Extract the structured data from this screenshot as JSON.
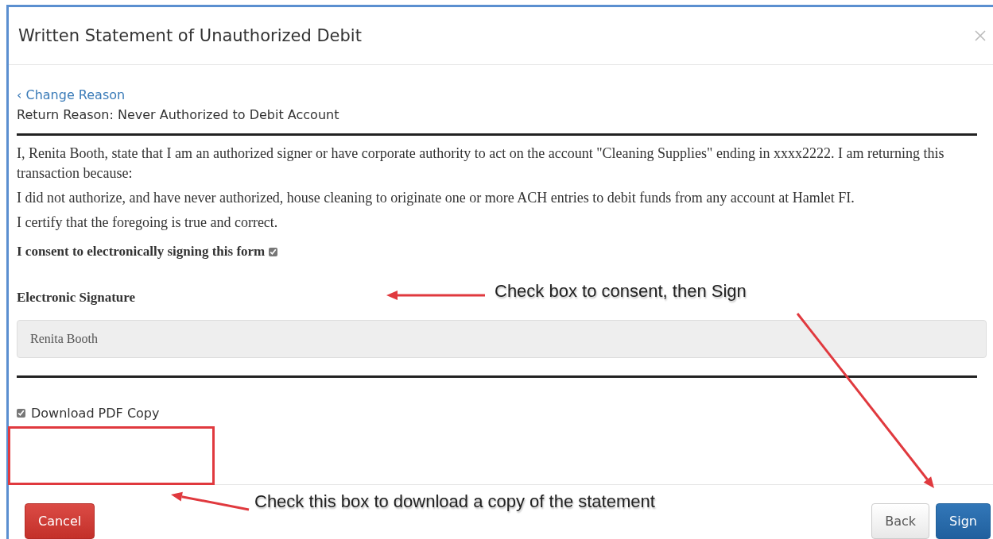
{
  "dialog": {
    "title": "Written Statement of Unauthorized Debit",
    "back_link": "‹ Change Reason",
    "return_reason": "Return Reason: Never Authorized to Debit Account",
    "paragraphs": [
      "I, Renita Booth, state that I am an authorized signer or have corporate authority to act on the account \"Cleaning Supplies\" ending in xxxx2222. I am returning this transaction because:",
      "I did not authorize, and have never authorized, house cleaning to originate one or more ACH entries to debit funds from any account at Hamlet FI.",
      "I certify that the foregoing is true and correct."
    ],
    "consent": {
      "label": "I consent to electronically signing this form",
      "checked": true
    },
    "signature": {
      "label": "Electronic Signature",
      "value": "Renita Booth"
    },
    "download": {
      "label": "Download PDF Copy",
      "checked": true
    },
    "buttons": [
      {
        "label": "Cancel",
        "kind": "danger"
      },
      {
        "label": "Back",
        "kind": "default"
      },
      {
        "label": "Sign",
        "kind": "primary"
      }
    ]
  },
  "annotations": [
    {
      "kind": "callout",
      "text": "Check box to consent, then Sign"
    },
    {
      "kind": "callout",
      "text": "Check this box to download a copy of the statement"
    }
  ]
}
